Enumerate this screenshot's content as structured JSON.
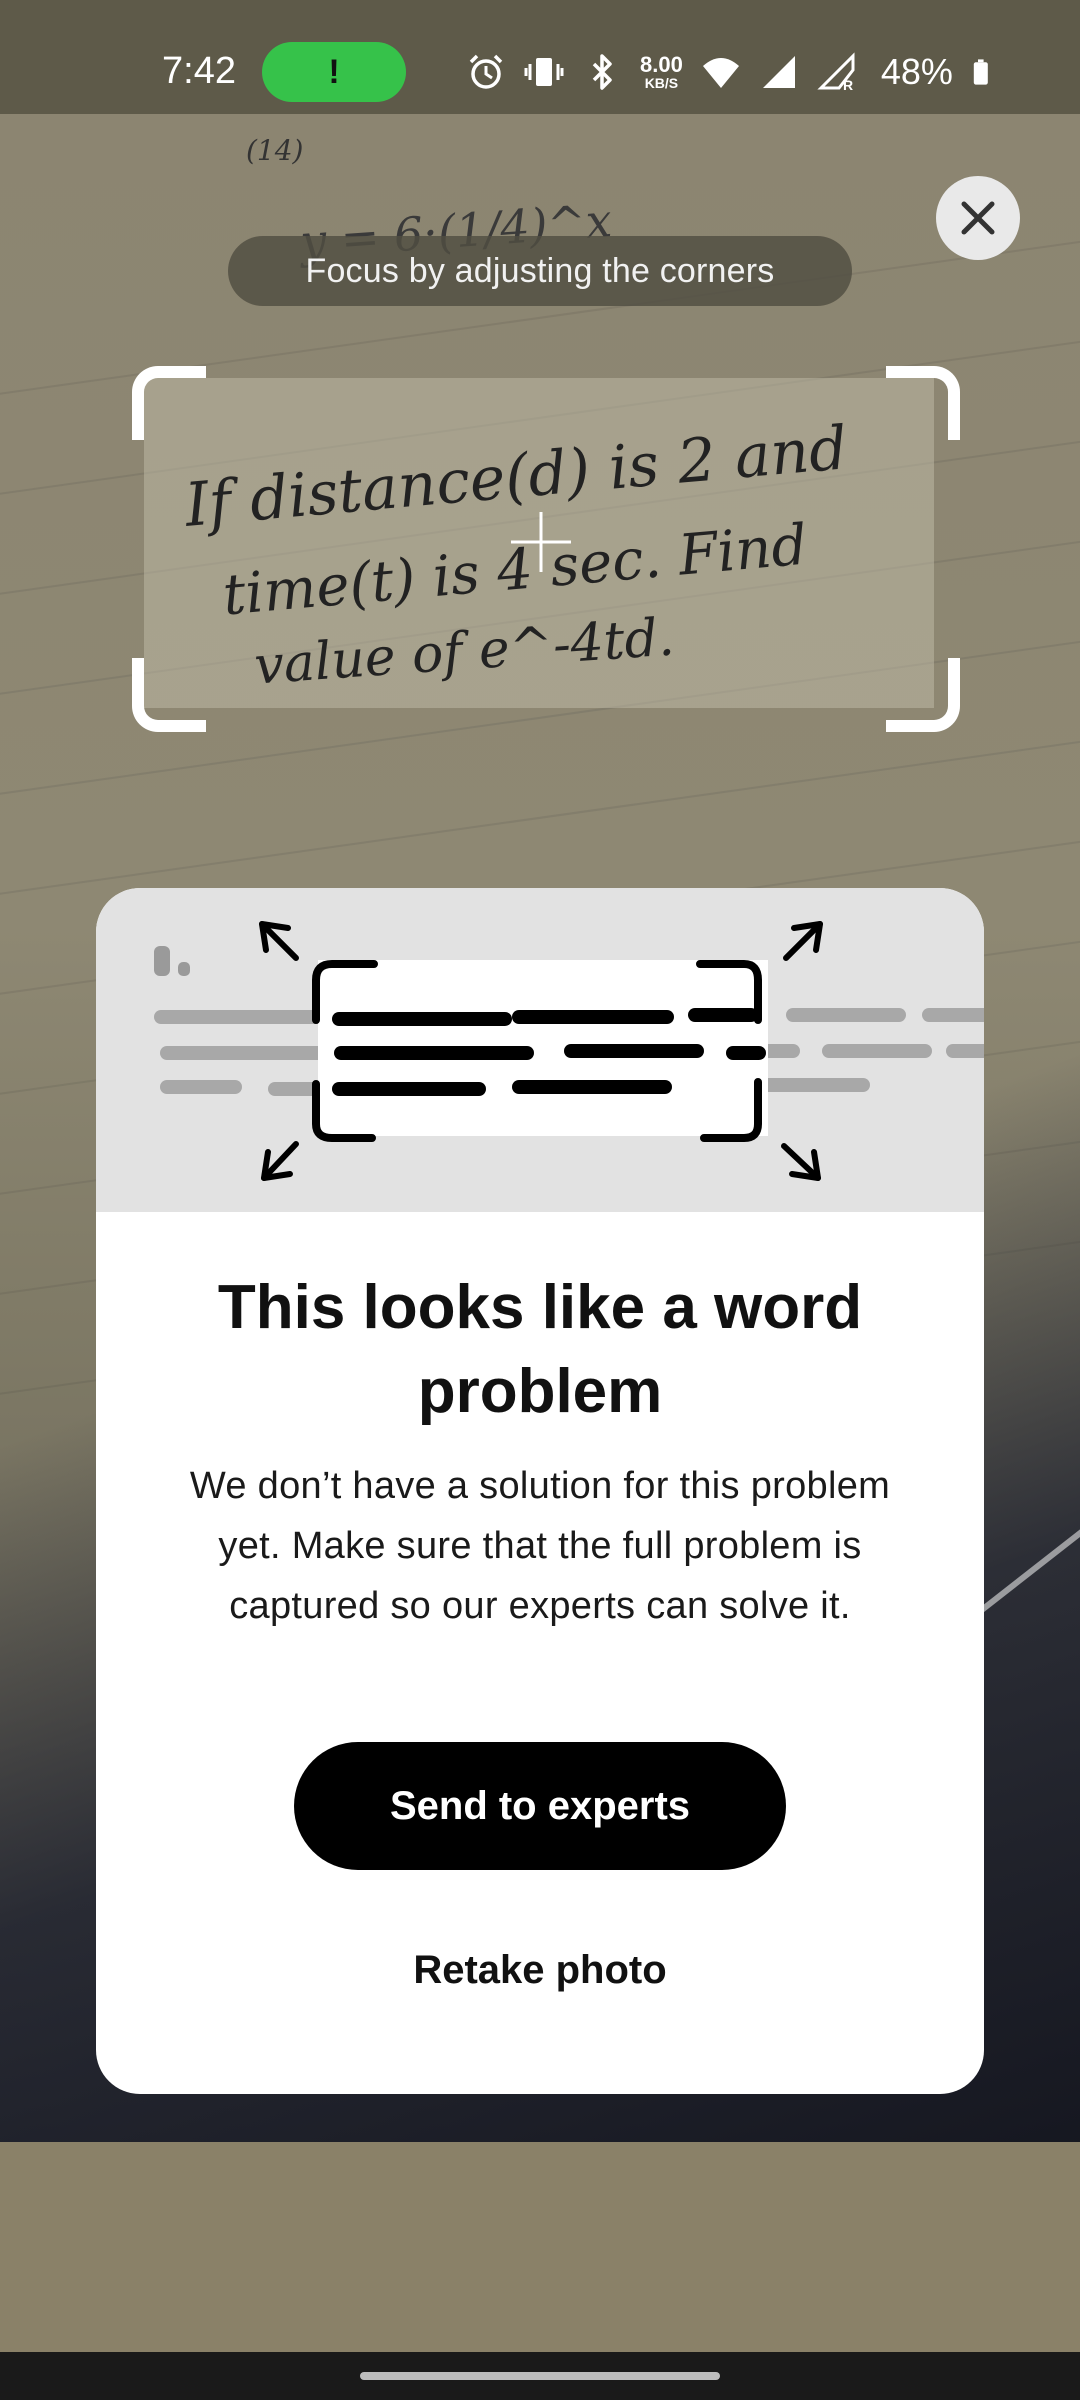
{
  "status_bar": {
    "time": "7:42",
    "alert_badge": "!",
    "net_speed_value": "8.00",
    "net_speed_unit": "KB/S",
    "battery_percent": "48%",
    "icons": [
      "alarm-icon",
      "vibrate-icon",
      "bluetooth-icon",
      "wifi-icon",
      "signal-icon",
      "signal-roaming-icon",
      "battery-icon"
    ]
  },
  "camera": {
    "hint": "Focus by adjusting the corners",
    "handwriting_top": [
      "(14)",
      "y = 6·(1/4)^x"
    ],
    "handwriting_lines": [
      "If distance(d) is 2 and",
      "time(t) is 4 sec. Find",
      "value of e^-4td."
    ]
  },
  "dialog": {
    "title": "This looks like a word problem",
    "body": "We don’t have a solution for this problem yet. Make sure that the full problem is captured so our experts can solve it.",
    "primary_button": "Send to experts",
    "secondary_button": "Retake photo"
  },
  "colors": {
    "status_pill": "#36c24a",
    "card_bg": "#ffffff",
    "primary_button_bg": "#000000"
  }
}
